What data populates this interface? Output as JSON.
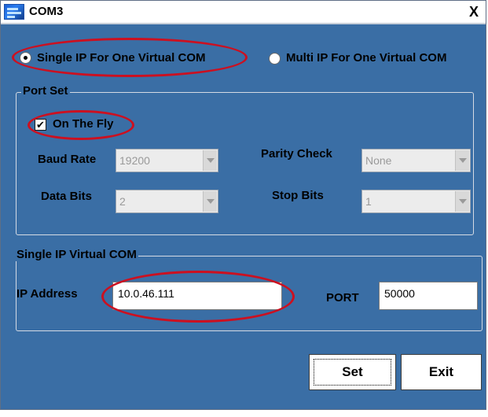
{
  "window": {
    "title": "COM3",
    "close_glyph": "X",
    "app_icon": "network-app-icon"
  },
  "mode": {
    "single_label": "Single IP For One Virtual COM",
    "multi_label": "Multi IP For One Virtual COM",
    "selected": "single"
  },
  "port_set": {
    "legend": "Port Set",
    "on_the_fly_label": "On The Fly",
    "on_the_fly_checked": true,
    "baud_rate_label": "Baud Rate",
    "baud_rate_value": "19200",
    "parity_label": "Parity Check",
    "parity_value": "None",
    "data_bits_label": "Data Bits",
    "data_bits_value": "2",
    "stop_bits_label": "Stop Bits",
    "stop_bits_value": "1"
  },
  "single_ip": {
    "legend": "Single IP Virtual COM",
    "ip_label": "IP Address",
    "ip_value": "10.0.46.111",
    "port_label": "PORT",
    "port_value": "50000"
  },
  "buttons": {
    "set_label": "Set",
    "exit_label": "Exit"
  },
  "highlight_color": "#cc1020",
  "window_bg": "#3a6ea5"
}
